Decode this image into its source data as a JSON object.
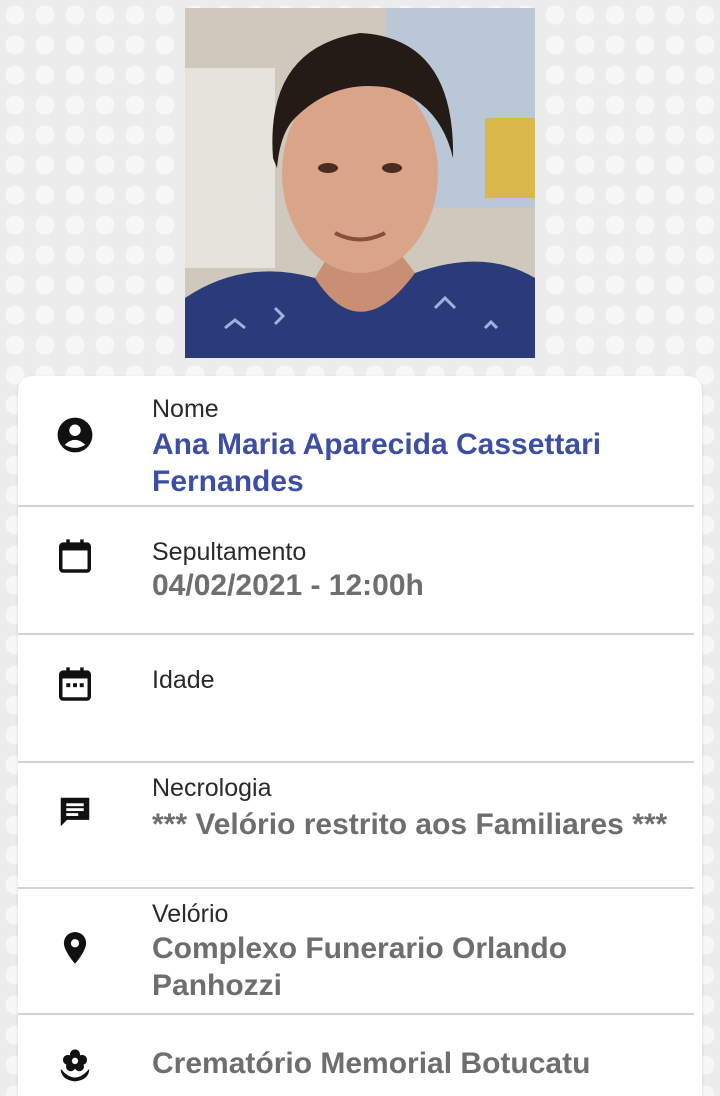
{
  "photo": {
    "icon": "portrait-photo"
  },
  "fields": {
    "nome": {
      "label": "Nome",
      "value": "Ana Maria Aparecida Cassettari Fernandes",
      "icon": "account-circle-icon"
    },
    "sepultamento": {
      "label": "Sepultamento",
      "value": "04/02/2021 - 12:00h",
      "icon": "calendar-icon"
    },
    "idade": {
      "label": "Idade",
      "value": "",
      "icon": "calendar-dots-icon"
    },
    "necrologia": {
      "label": "Necrologia",
      "value": "*** Velório restrito aos Familiares ***",
      "icon": "message-icon"
    },
    "velorio": {
      "label": "Velório",
      "value": "Complexo Funerario Orlando Panhozzi",
      "icon": "location-pin-icon"
    },
    "cremacao": {
      "label": "",
      "value": "Crematório Memorial Botucatu",
      "icon": "flower-icon"
    }
  },
  "colors": {
    "name_value": "#3d4fa5",
    "value_text": "#6e6e6e",
    "label_text": "#2a2a2a"
  }
}
